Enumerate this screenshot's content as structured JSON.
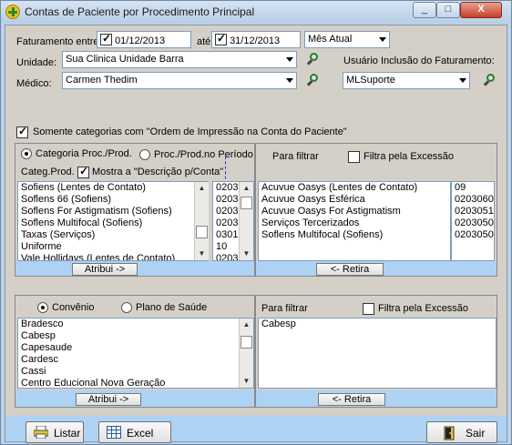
{
  "window": {
    "title": "Contas de Paciente por Procedimento Principal"
  },
  "controls": {
    "minimize": "_",
    "maximize": "□",
    "close": "X"
  },
  "filters": {
    "faturamento_label": "Faturamento entre:",
    "date_from": "01/12/2013",
    "ate_label": "até",
    "date_to": "31/12/2013",
    "period": "Mês Atual",
    "unidade_label": "Unidade:",
    "unidade_value": "Sua Clinica Unidade Barra",
    "medico_label": "Médico:",
    "medico_value": "Carmen Thedim",
    "usuario_label": "Usuário Inclusão do Faturamento:",
    "usuario_value": "MLSuporte"
  },
  "ordem_check_label": "Somente categorias com \"Ordem de Impressão na Conta do Paciente\"",
  "categorias": {
    "radio1": "Categoria Proc./Prod.",
    "radio2": "Proc./Prod.no Período",
    "categ_label": "Categ.Prod.",
    "mostra_label": "Mostra a \"Descrição p/Conta\"",
    "items": [
      {
        "name": "Sofiens (Lentes de Contato)",
        "code": "0203"
      },
      {
        "name": "Soflens 66 (Sofiens)",
        "code": "0203"
      },
      {
        "name": "Soflens For Astigmatism (Sofiens)",
        "code": "0203"
      },
      {
        "name": "Soflens Multifocal (Sofiens)",
        "code": "0203"
      },
      {
        "name": "Taxas (Serviços)",
        "code": "0301"
      },
      {
        "name": "Uniforme",
        "code": "10"
      },
      {
        "name": "Vale Hollidays (Lentes de Contato)",
        "code": "0203"
      }
    ],
    "atribui": "Atribui ->",
    "filtrar_label": "Para filtrar",
    "excessao_label": "Filtra pela Excessão",
    "selected": [
      {
        "name": "Acuvue Oasys (Lentes de Contato)",
        "code": "09"
      },
      {
        "name": "Acuvue Oasys Esférica",
        "code": "0203060"
      },
      {
        "name": "Acuvue Oasys For Astigmatism",
        "code": "0203051"
      },
      {
        "name": "Serviços Tercerizados",
        "code": "0203050"
      },
      {
        "name": "Soflens Multifocal (Sofiens)",
        "code": "0203050"
      }
    ],
    "retira": "<- Retira"
  },
  "convenios": {
    "radio1": "Convênio",
    "radio2": "Plano de Saúde",
    "items": [
      "Bradesco",
      "Cabesp",
      "Capesaude",
      "Cardesc",
      "Cassi",
      "Centro Educional Nova Geração"
    ],
    "atribui": "Atribui ->",
    "filtrar_label": "Para filtrar",
    "excessao_label": "Filtra pela Excessão",
    "selected": [
      "Cabesp"
    ],
    "retira": "<- Retira"
  },
  "footer": {
    "listar": "Listar",
    "excel": "Excel",
    "sair": "Sair"
  }
}
